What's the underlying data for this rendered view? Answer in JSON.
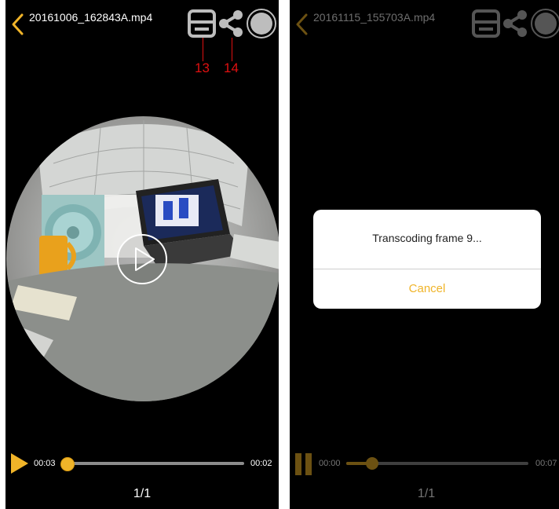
{
  "colors": {
    "accent": "#f0b429",
    "callout": "#e01010",
    "background": "#000000"
  },
  "left_screen": {
    "filename": "20161006_162843A.mp4",
    "icons": [
      "back-chevron-icon",
      "save-icon",
      "share-icon",
      "record-icon",
      "play-overlay-icon"
    ],
    "callouts": [
      "13",
      "14"
    ],
    "playback": {
      "elapsed": "00:03",
      "total": "00:02",
      "progress": 0.0
    },
    "page": "1/1"
  },
  "right_screen": {
    "filename": "20161115_155703A.mp4",
    "icons": [
      "back-chevron-icon",
      "save-icon",
      "share-icon",
      "record-icon",
      "pause-icon"
    ],
    "playback": {
      "elapsed": "00:00",
      "total": "00:07",
      "progress": 0.14
    },
    "page": "1/1",
    "dialog": {
      "message": "Transcoding frame 9...",
      "cancel_label": "Cancel"
    }
  }
}
